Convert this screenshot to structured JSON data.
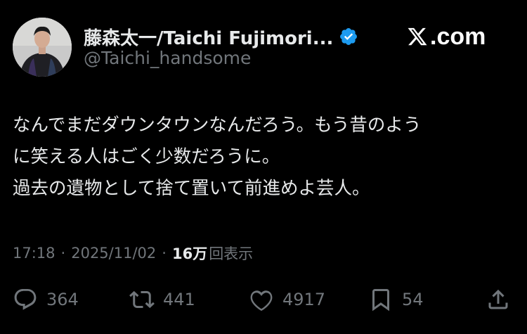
{
  "author": {
    "display_name": "藤森太一/Taichi Fujimori...",
    "handle": "@Taichi_handsome",
    "verified_color": "#1d9bf0",
    "avatar_icon": "person-photo"
  },
  "brand": {
    "label": ".com",
    "icon": "x-logo-icon"
  },
  "tweet": {
    "lines": [
      "なんでまだダウンタウンなんだろう。もう昔のよう",
      "に笑える人はごく少数だろうに。",
      "過去の遺物として捨て置いて前進めよ芸人。"
    ]
  },
  "meta": {
    "time": "17:18",
    "separator": "·",
    "date": "2025/11/02",
    "views_count": "16万",
    "views_label": "回表示"
  },
  "actions": {
    "replies": "364",
    "reposts": "441",
    "likes": "4917",
    "bookmarks": "54"
  },
  "colors": {
    "background": "#000000",
    "primary_text": "#e7e9ea",
    "secondary_text": "#71767b",
    "accent": "#1d9bf0"
  }
}
